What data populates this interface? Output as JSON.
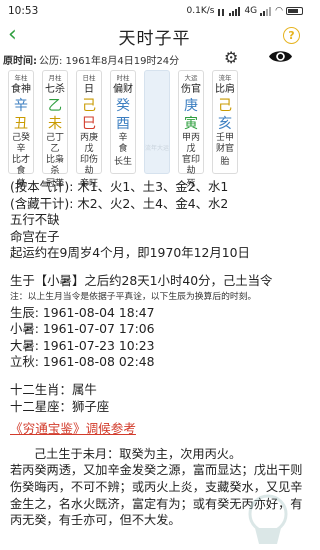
{
  "status": {
    "time": "10:53",
    "speed": "0.1K/s",
    "network": "4G",
    "colors": {
      "text": "#222222"
    }
  },
  "header": {
    "title": "天时子平",
    "back_icon": "chevron-left-icon",
    "help_icon": "question-circle-icon",
    "accent": "#2e9e3e",
    "help_color": "#e6b422"
  },
  "dob": {
    "label": "原时间:",
    "value": "公历: 1961年8月4日19时24分",
    "settings_icon": "gear-icon",
    "toggle_icon": "eye-icon"
  },
  "pillars": [
    {
      "label": "年柱",
      "god": "食神",
      "stem": "辛",
      "stem_color": "#3d7fc1",
      "branch": "丑",
      "branch_color": "#c99a00",
      "hidden": [
        "己癸辛",
        "比才食"
      ],
      "stage": "墓"
    },
    {
      "label": "月柱",
      "god": "七杀",
      "stem": "乙",
      "stem_color": "#2e9e3e",
      "branch": "未",
      "branch_color": "#c99a00",
      "hidden": [
        "己丁乙",
        "比枭杀"
      ],
      "stage": "冠带"
    },
    {
      "label": "日柱",
      "god": "日",
      "stem": "己",
      "stem_color": "#c99a00",
      "branch": "巳",
      "branch_color": "#d23b2b",
      "hidden": [
        "丙庚戊",
        "印伤劫"
      ],
      "stage": "帝旺"
    },
    {
      "label": "时柱",
      "god": "偏财",
      "stem": "癸",
      "stem_color": "#3d7fc1",
      "branch": "酉",
      "branch_color": "#3d7fc1",
      "hidden": [
        "辛",
        "食"
      ],
      "stage": "长生"
    }
  ],
  "blank_caption": "流年大运",
  "luck_pillars": [
    {
      "label": "大运",
      "god": "伤官",
      "stem": "庚",
      "stem_color": "#3d7fc1",
      "branch": "寅",
      "branch_color": "#2e9e3e",
      "hidden": [
        "甲丙戊",
        "官印劫"
      ],
      "stage": "死"
    },
    {
      "label": "流年",
      "god": "比肩",
      "stem": "己",
      "stem_color": "#c99a00",
      "branch": "亥",
      "branch_color": "#3d7fc1",
      "hidden": [
        "壬甲",
        "财官"
      ],
      "stage": "胎"
    }
  ],
  "content": {
    "line1": "(按本气计): 木1、火1、土3、金2、水1",
    "line2": "(含藏干计): 木2、火2、土4、金4、水2",
    "line3": "五行不缺",
    "line4": "命宫在子",
    "line5": "起运约在9周岁4个月，即1970年12月10日",
    "line6": "生于【小暑】之后约28天1小时40分，己土当令",
    "note": "注：以上生月当令是依据子平真诠，以下生辰为换算后的时刻。",
    "births": [
      "生辰: 1961-08-04 18:47",
      "小暑: 1961-07-07 17:06",
      "大暑: 1961-07-23 10:23",
      "立秋: 1961-08-08 02:48"
    ],
    "zodiac": "十二生肖：属牛",
    "constellation": "十二星座：狮子座",
    "section_title": "《穷通宝鉴》调候参考",
    "para1": "己土生于未月：取癸为主，次用丙火。",
    "para2": "若丙癸两透，又加辛金发癸之源，富而显达；戊出干则伤癸晦丙，不可不辨；或丙火上炎，支藏癸水，又见辛金生之，名水火既济，富定有为；或有癸无丙亦好，有丙无癸，有壬亦可，但不大发。"
  }
}
